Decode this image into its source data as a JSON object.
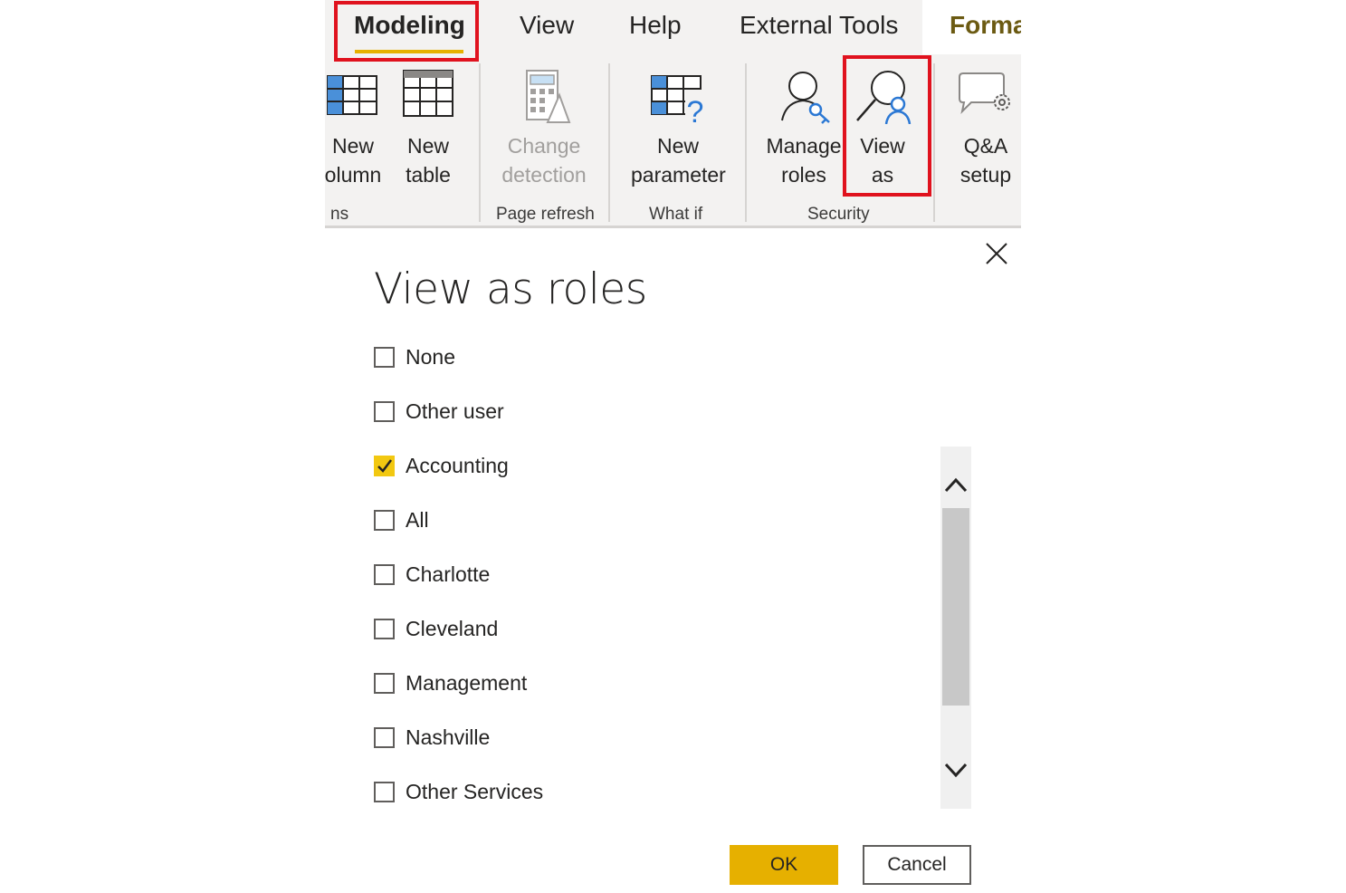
{
  "ribbon": {
    "tabs": {
      "modeling": "Modeling",
      "view": "View",
      "help": "Help",
      "external_tools": "External Tools",
      "format": "Forma"
    },
    "buttons": {
      "new_column": "New\nolumn",
      "new_table": "New\ntable",
      "change_detection": "Change\ndetection",
      "new_parameter": "New\nparameter",
      "manage_roles": "Manage\nroles",
      "view_as": "View\nas",
      "qa_setup": "Q&A\nsetup"
    },
    "groups": {
      "calculations": "ns",
      "page_refresh": "Page refresh",
      "what_if": "What if",
      "security": "Security"
    },
    "accent_color": "#e6b000",
    "highlight_color": "#e0121e"
  },
  "dialog": {
    "title": "View as roles",
    "roles": [
      {
        "label": "None",
        "checked": false
      },
      {
        "label": "Other user",
        "checked": false
      },
      {
        "label": "Accounting",
        "checked": true
      },
      {
        "label": "All",
        "checked": false
      },
      {
        "label": "Charlotte",
        "checked": false
      },
      {
        "label": "Cleveland",
        "checked": false
      },
      {
        "label": "Management",
        "checked": false
      },
      {
        "label": "Nashville",
        "checked": false
      },
      {
        "label": "Other Services",
        "checked": false
      }
    ],
    "ok_label": "OK",
    "cancel_label": "Cancel",
    "checkbox_checked_color": "#f2c811",
    "ok_color": "#e6b000"
  }
}
